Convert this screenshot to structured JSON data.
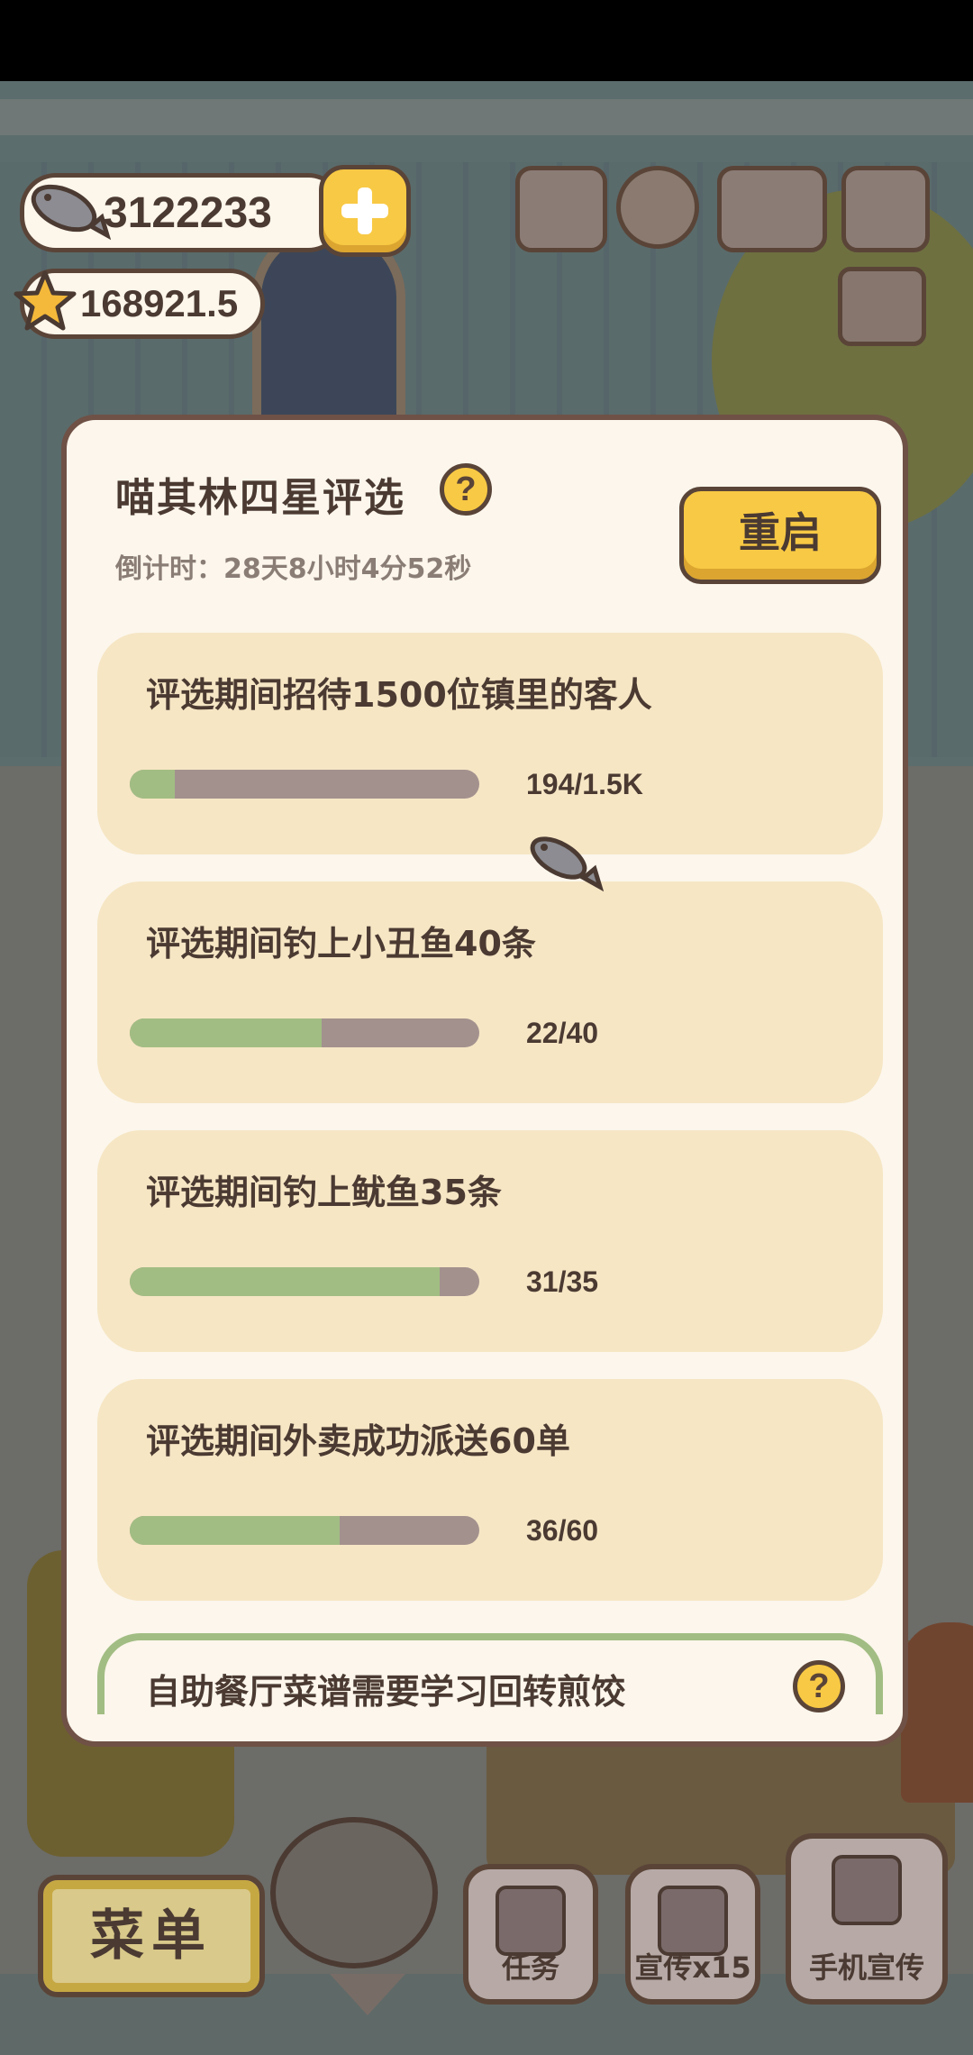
{
  "hud": {
    "fish_count": "3122233",
    "star_rating": "168921.5"
  },
  "dialog": {
    "title": "喵其林四星评选",
    "countdown": "倒计时：28天8小时4分52秒",
    "restart_label": "重启",
    "help_symbol": "?",
    "tasks": [
      {
        "label": "评选期间招待1500位镇里的客人",
        "progress_text": "194/1.5K",
        "progress": 0.13
      },
      {
        "label": "评选期间钓上小丑鱼40条",
        "progress_text": "22/40",
        "progress": 0.55
      },
      {
        "label": "评选期间钓上鱿鱼35条",
        "progress_text": "31/35",
        "progress": 0.886
      },
      {
        "label": "评选期间外卖成功派送60单",
        "progress_text": "36/60",
        "progress": 0.6
      },
      {
        "label": "自助餐厅菜谱需要学习回转煎饺"
      }
    ]
  },
  "bottom_bar": {
    "menu_label": "菜单",
    "task_label": "任务",
    "promo_label": "宣传x15",
    "phone_promo_label": "手机宣传"
  },
  "colors": {
    "accent_yellow": "#f8c944",
    "progress_green": "#a2bd83",
    "progress_track": "#a3918e",
    "task_card": "#f6e6c4",
    "dialog_bg": "#fcf6ec",
    "outline_brown": "#5a4438"
  }
}
